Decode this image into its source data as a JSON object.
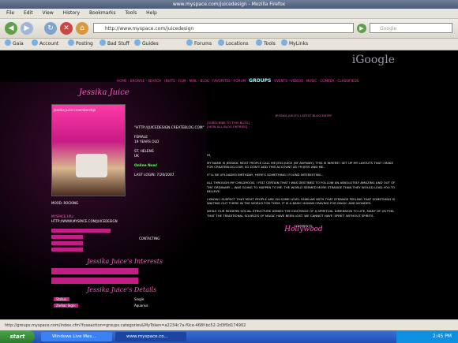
{
  "window": {
    "title": "www.myspace.com/juicedesign - Mozilla Firefox"
  },
  "menu": [
    "File",
    "Edit",
    "View",
    "History",
    "Bookmarks",
    "Tools",
    "Help"
  ],
  "nav": {
    "url": "http://www.myspace.com/juicedesign",
    "search_placeholder": "Google"
  },
  "bookmarks": [
    "Gaia",
    "Account",
    "Posting",
    "Bad Stuff",
    "Guides",
    "Forums",
    "Locations",
    "Tools",
    "MyLinks"
  ],
  "page": {
    "google_logo": "iGoogle",
    "profile_nav": [
      "HOME",
      "BROWSE",
      "SEARCH",
      "INVITE",
      "FILM",
      "MAIL",
      "BLOG",
      "FAVORITES",
      "FORUM",
      "GROUPS",
      "EVENTS",
      "VIDEOS",
      "MUSIC",
      "COMEDY",
      "CLASSIFIEDS"
    ],
    "profile_nav_active": "GROUPS",
    "name_title": "Jessika Juice",
    "photo_caption": "Jessika Juice+membership",
    "info": {
      "url_line": "\"HTTP://JUICEDESIGN.CREATEBLOG.COM\"",
      "gender": "FEMALE",
      "age": "19 YEARS OLD",
      "location": "ST. HELENS",
      "country": "UK",
      "online": "Online Now!",
      "last_login": "LAST LOGIN: 7/20/2007"
    },
    "mood": "MOOD: ROCKING",
    "url_label": "MYSPACE URL:",
    "myspace_url": "HTTP://WWW.MYSPACE.COM/JUICEDESIGN",
    "contact_label": "CONTACTING",
    "interests_title": "Jessika Juice's Interests",
    "details_title": "Jessika Juice's Details",
    "details": [
      {
        "k": "Status:",
        "v": "Single"
      },
      {
        "k": "Zodiac Sign:",
        "v": "Aquarius"
      }
    ],
    "blog_heading": "JESSIKA JUICE'S LATEST BLOG ENTRY",
    "blog_links": [
      "[SUBSCRIBE TO THIS BLOG]",
      "[VIEW ALL BLOG ENTRIES]"
    ],
    "about_paragraphs": [
      "HI,",
      "MY NAME IS JESSIKA. MOST PEOPLE CALL ME JESS JUICE (BY ANYWAY). THIS IS WHERE I SET UP MY LAYOUTS THAT I MAKE FOR CREATEBLOG.COM, SO DON'T ADD THIS ACCOUNT AS I'M JESS AND ME..",
      "IT'LL BE UPLOADED BIRTHDAY, HERE'S SOMETHING I FOUND INTERESTING..",
      "ALL THROUGH MY CHILDHOOD, I FELT CERTAIN THAT I WAS DESTINED TO FOLLOW AN ABSOLUTELY AMAZING AND OUT OF THE ORDINARY -- WAS GOING TO HAPPEN TO ME. THE WORLD SEEMED MORE STRANGE THAN THEY WOULD LEAD YOU TO BELIEVE.",
      "I KNOW I SUSPECT THAT MOST PEOPLE ARE ON SOME LEVEL FAMILIAR WITH THAT STRANGE FEELING THAT SOMETHING IS WAITING OUT THERE IN THE WORLD FOR THEM. IT IS A BASIC HUMAN CRAVING FOR MAGIC AND WONDER.",
      "WHILE OUR MODERN SOCIAL STRUCTURE DENIES THE EXISTENCE OF A SPIRITUAL DIMENSION TO LIFE, MANY OF US FEEL THAT THE TRADITIONAL SOURCES OF MAGIC HAVE BEEN LOST. WE CANNOT HAVE 'SPIRIT' WITHOUT SPIRITS."
    ],
    "comments_label": "COMMENTS:",
    "sig": "Hollywood"
  },
  "status": {
    "text": "http://groups.myspace.com/index.cfm?fuseaction=groups.categories&MyToken=a2234c7a-f0ce-468f-bc52-2d3f0d174902"
  },
  "taskbar": {
    "start": "start",
    "tasks": [
      "Windows Live Mes...",
      "www.myspace.co..."
    ],
    "clock": "2:45 PM"
  }
}
